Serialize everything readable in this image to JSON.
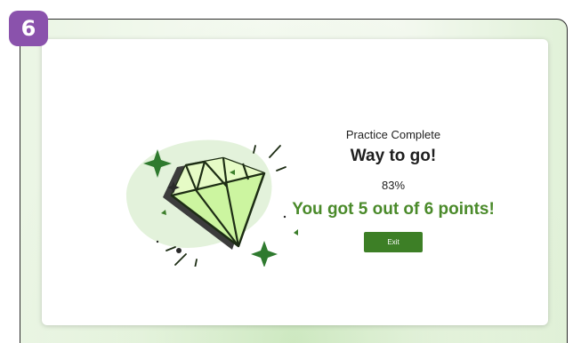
{
  "badge": {
    "number": "6"
  },
  "result": {
    "status_text": "Practice Complete",
    "headline": "Way to go!",
    "percent": "83%",
    "score_text": "You got 5 out of 6 points!",
    "exit_label": "Exit"
  },
  "colors": {
    "badge_purple": "#8a52ac",
    "accent_green": "#4a8a2a",
    "button_green": "#3d7f26",
    "gem_light": "#ccf5a0",
    "blob_green": "#e3f2db"
  },
  "icons": [
    "diamond-illustration-icon",
    "sparkle-icon"
  ]
}
